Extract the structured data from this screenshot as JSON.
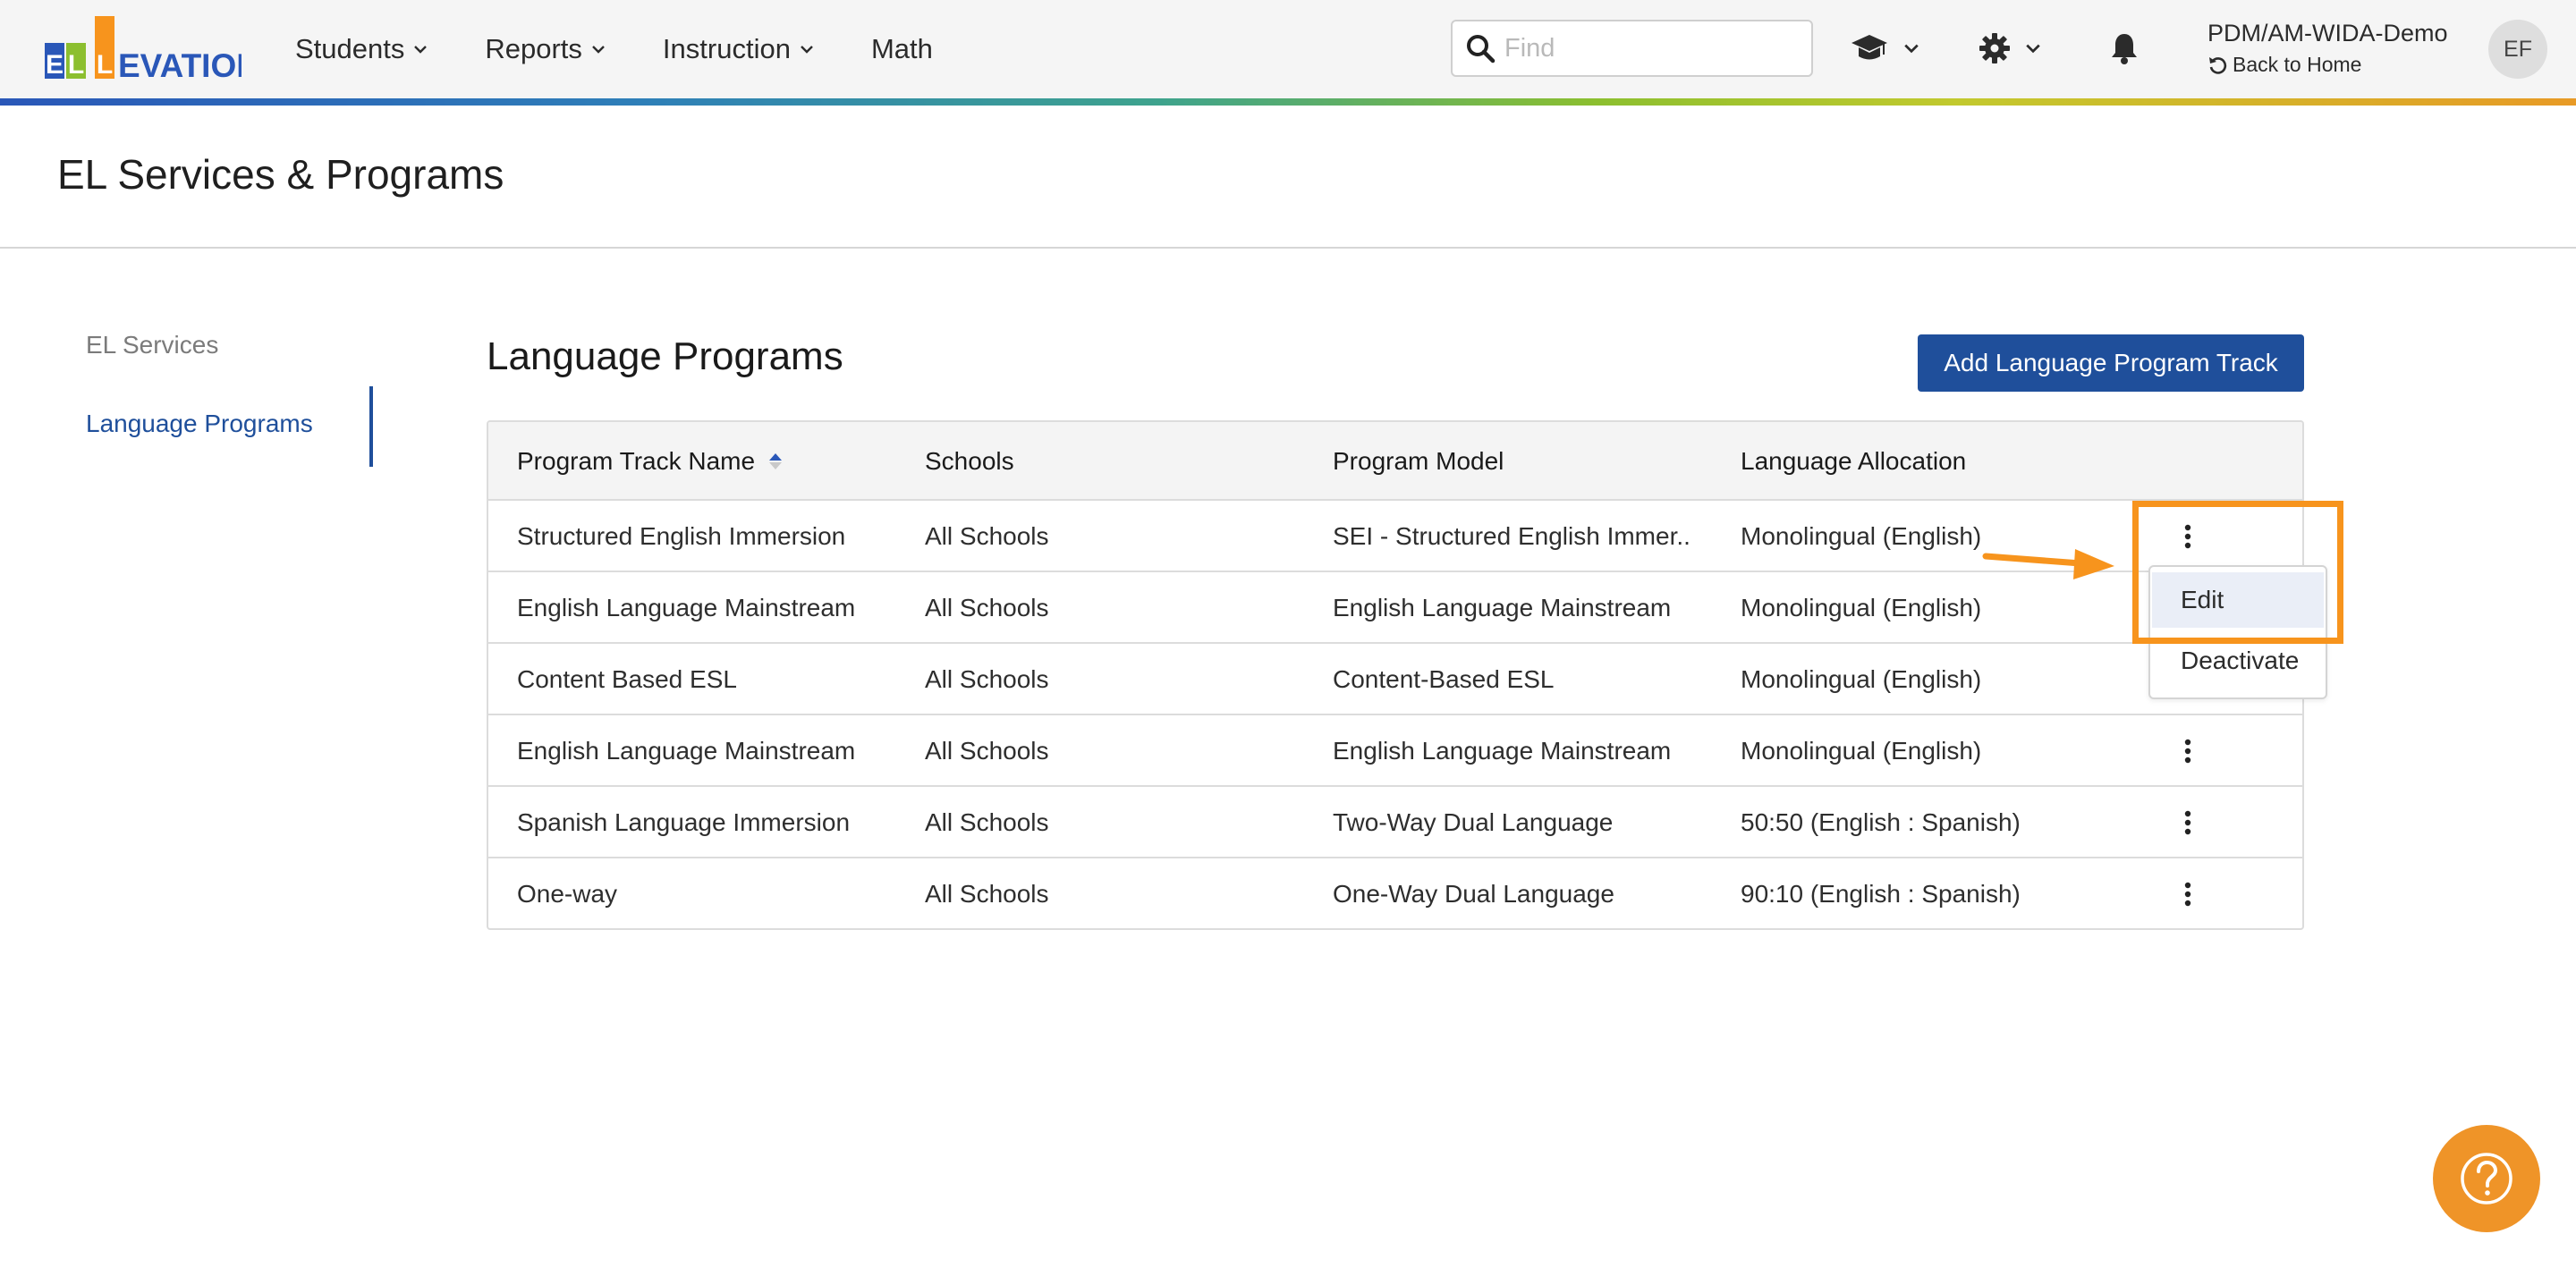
{
  "app": {
    "logo_text": "ELLEVATION",
    "nav": [
      {
        "label": "Students"
      },
      {
        "label": "Reports"
      },
      {
        "label": "Instruction"
      },
      {
        "label": "Math"
      }
    ],
    "search_placeholder": "Find",
    "user": {
      "account": "PDM/AM-WIDA-Demo",
      "back_label": "Back to Home",
      "initials": "EF"
    }
  },
  "page": {
    "title": "EL Services & Programs"
  },
  "sidebar": {
    "items": [
      {
        "label": "EL Services",
        "active": false
      },
      {
        "label": "Language Programs",
        "active": true
      }
    ]
  },
  "main": {
    "section_title": "Language Programs",
    "add_button": "Add Language Program Track",
    "table": {
      "columns": [
        "Program Track Name",
        "Schools",
        "Program Model",
        "Language Allocation"
      ],
      "rows": [
        {
          "name": "Structured English Immersion",
          "schools": "All Schools",
          "model": "SEI - Structured English Immer...",
          "allocation": "Monolingual (English)"
        },
        {
          "name": "English Language Mainstream",
          "schools": "All Schools",
          "model": "English Language Mainstream",
          "allocation": "Monolingual (English)"
        },
        {
          "name": "Content Based ESL",
          "schools": "All Schools",
          "model": "Content-Based ESL",
          "allocation": "Monolingual (English)"
        },
        {
          "name": "English Language Mainstream",
          "schools": "All Schools",
          "model": "English Language Mainstream",
          "allocation": "Monolingual (English)"
        },
        {
          "name": "Spanish Language Immersion",
          "schools": "All Schools",
          "model": "Two-Way Dual Language",
          "allocation": "50:50 (English : Spanish)"
        },
        {
          "name": "One-way",
          "schools": "All Schools",
          "model": "One-Way Dual Language",
          "allocation": "90:10 (English : Spanish)"
        }
      ]
    },
    "row_menu": {
      "items": [
        "Edit",
        "Deactivate"
      ]
    }
  },
  "colors": {
    "brand_blue": "#1f4f9b",
    "annotation_orange": "#f7941d",
    "help_orange": "#ef9428"
  }
}
